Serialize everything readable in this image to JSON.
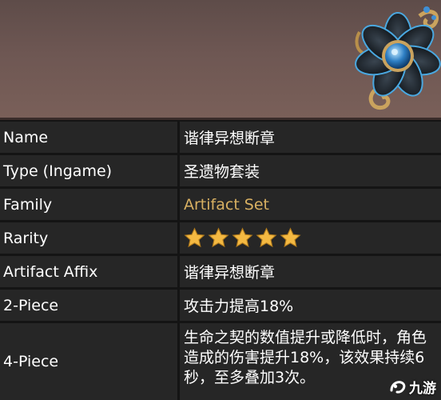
{
  "artifact": {
    "icon": "black-blue-flower-brooch-icon"
  },
  "table": {
    "rows": [
      {
        "label": "Name",
        "value": "谐律异想断章"
      },
      {
        "label": "Type (Ingame)",
        "value": "圣遗物套装"
      },
      {
        "label": "Family",
        "value": "Artifact Set"
      },
      {
        "label": "Rarity",
        "stars": 5
      },
      {
        "label": "Artifact Affix",
        "value": "谐律异想断章"
      },
      {
        "label": "2-Piece",
        "value": "攻击力提高18%"
      },
      {
        "label": "4-Piece",
        "value": "生命之契的数值提升或降低时，角色造成的伤害提升18%，该效果持续6秒，至多叠加3次。"
      }
    ]
  },
  "watermark": {
    "text": "九游",
    "icon": "jiuyou-logo-icon"
  },
  "colors": {
    "row_background": "#262626",
    "link_text": "#d8b062",
    "star": "#f4b942"
  }
}
